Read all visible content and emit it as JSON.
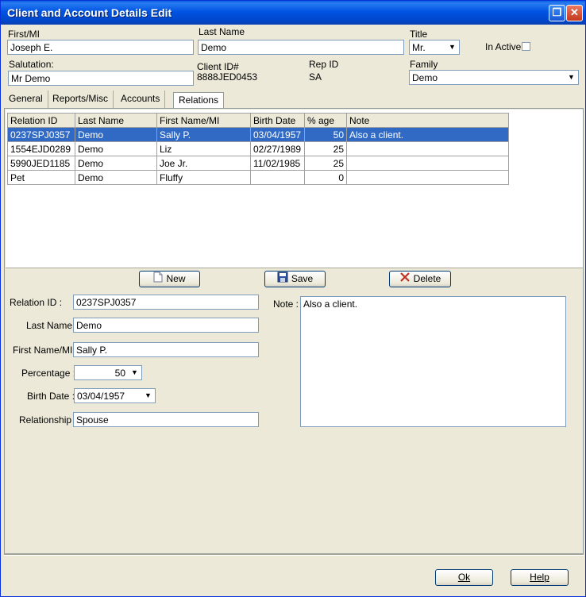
{
  "window": {
    "title": "Client and Account Details Edit"
  },
  "header": {
    "first_label": "First/MI",
    "first_value": "Joseph E.",
    "last_label": "Last Name",
    "last_value": "Demo",
    "title_label": "Title",
    "title_value": "Mr.",
    "inactive_label": "In Active",
    "salutation_label": "Salutation:",
    "salutation_value": "Mr Demo",
    "clientid_label": "Client ID#",
    "clientid_value": "8888JED0453",
    "repid_label": "Rep ID",
    "repid_value": "SA",
    "family_label": "Family",
    "family_value": "Demo"
  },
  "tabs": [
    "General",
    "Reports/Misc",
    "Accounts",
    "Relations"
  ],
  "grid": {
    "columns": [
      "Relation ID",
      "Last Name",
      "First Name/MI",
      "Birth Date",
      "% age",
      "Note"
    ],
    "rows": [
      [
        "0237SPJ0357",
        "Demo",
        "Sally P.",
        "03/04/1957",
        "50",
        "Also a client."
      ],
      [
        "1554EJD0289",
        "Demo",
        "Liz",
        "02/27/1989",
        "25",
        ""
      ],
      [
        "5990JED1185",
        "Demo",
        "Joe Jr.",
        "11/02/1985",
        "25",
        ""
      ],
      [
        "Pet",
        "Demo",
        "Fluffy",
        "",
        "0",
        ""
      ]
    ]
  },
  "actions": {
    "new": "New",
    "save": "Save",
    "delete": "Delete"
  },
  "detail": {
    "relation_id_label": "Relation ID :",
    "relation_id_value": "0237SPJ0357",
    "last_name_label": "Last Name :",
    "last_name_value": "Demo",
    "first_name_label": "First Name/MI :",
    "first_name_value": "Sally P.",
    "percentage_label": "Percentage :",
    "percentage_value": "50",
    "birth_date_label": "Birth Date :",
    "birth_date_value": "03/04/1957",
    "relationship_label": "Relationship :",
    "relationship_value": "Spouse",
    "note_label": "Note :",
    "note_value": "Also a client."
  },
  "footer": {
    "ok_label": "Ok",
    "help_label": "Help"
  },
  "colors": {
    "titlebar": "#0054e3",
    "selection": "#316ac5",
    "dialog_bg": "#ece9d8"
  }
}
